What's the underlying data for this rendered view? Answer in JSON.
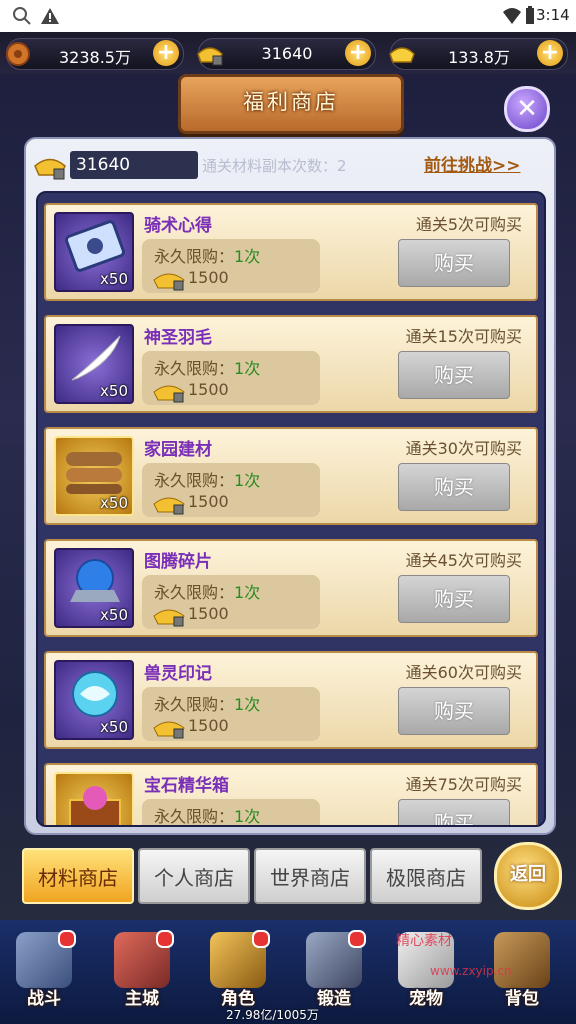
{
  "status_bar": {
    "time": "3:14"
  },
  "currency": [
    {
      "icon": "copper-coin-icon",
      "value": "3238.5万"
    },
    {
      "icon": "locked-gold-ingot-icon",
      "value": "31640"
    },
    {
      "icon": "gold-ingot-icon",
      "value": "133.8万"
    }
  ],
  "title": "福利商店",
  "panel": {
    "points": "31640",
    "dungeon_label": "通关材料副本次数：2",
    "challenge_link": "前往挑战>>"
  },
  "items": [
    {
      "name": "骑术心得",
      "qty": "x50",
      "limit_label": "永久限购：",
      "limit_value": "1次",
      "cost": "1500",
      "requirement": "通关5次可购买",
      "buy_label": "购买",
      "icon": "riding-manual-icon",
      "frame": "purple"
    },
    {
      "name": "神圣羽毛",
      "qty": "x50",
      "limit_label": "永久限购：",
      "limit_value": "1次",
      "cost": "1500",
      "requirement": "通关15次可购买",
      "buy_label": "购买",
      "icon": "white-feather-icon",
      "frame": "purple"
    },
    {
      "name": "家园建材",
      "qty": "x50",
      "limit_label": "永久限购：",
      "limit_value": "1次",
      "cost": "1500",
      "requirement": "通关30次可购买",
      "buy_label": "购买",
      "icon": "logs-icon",
      "frame": "gold"
    },
    {
      "name": "图腾碎片",
      "qty": "x50",
      "limit_label": "永久限购：",
      "limit_value": "1次",
      "cost": "1500",
      "requirement": "通关45次可购买",
      "buy_label": "购买",
      "icon": "blue-orb-icon",
      "frame": "purple"
    },
    {
      "name": "兽灵印记",
      "qty": "x50",
      "limit_label": "永久限购：",
      "limit_value": "1次",
      "cost": "1500",
      "requirement": "通关60次可购买",
      "buy_label": "购买",
      "icon": "dragon-orb-icon",
      "frame": "purple"
    },
    {
      "name": "宝石精华箱",
      "qty": "",
      "limit_label": "永久限购：",
      "limit_value": "1次",
      "cost": "",
      "requirement": "通关75次可购买",
      "buy_label": "购买",
      "icon": "treasure-chest-icon",
      "frame": "gold"
    }
  ],
  "tabs": [
    {
      "label": "材料商店",
      "active": true
    },
    {
      "label": "个人商店",
      "active": false
    },
    {
      "label": "世界商店",
      "active": false
    },
    {
      "label": "极限商店",
      "active": false
    }
  ],
  "back_button": "返回",
  "nav": [
    {
      "label": "战斗",
      "icon": "crossed-swords-icon"
    },
    {
      "label": "主城",
      "icon": "castle-icon"
    },
    {
      "label": "角色",
      "icon": "helmet-icon"
    },
    {
      "label": "锻造",
      "icon": "anvil-icon"
    },
    {
      "label": "宠物",
      "icon": "pet-icon"
    },
    {
      "label": "背包",
      "icon": "bag-icon"
    }
  ],
  "power_readout": "27.98亿/1005万",
  "watermark": {
    "line1": "精心素材",
    "line2": "www.zxyip.cn"
  }
}
